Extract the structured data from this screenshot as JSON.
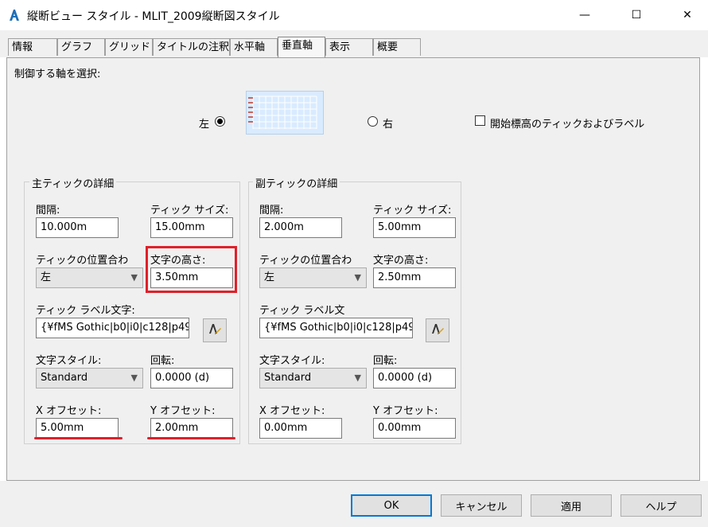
{
  "window": {
    "title": "縦断ビュー スタイル - MLIT_2009縦断図スタイル",
    "minimize": "—",
    "maximize": "☐",
    "close": "✕"
  },
  "tabs": [
    "情報",
    "グラフ",
    "グリッド",
    "タイトルの注釈",
    "水平軸",
    "垂直軸",
    "表示",
    "概要"
  ],
  "active_tab": "垂直軸",
  "axis_select": {
    "label": "制御する軸を選択:",
    "left_label": "左",
    "right_label": "右",
    "selected": "左",
    "checkbox_label": "開始標高のティックおよびラベル",
    "checkbox_checked": false
  },
  "major": {
    "title": "主ティックの詳細",
    "interval_label": "間隔:",
    "interval_value": "10.000m",
    "tick_size_label": "ティック サイズ:",
    "tick_size_value": "15.00mm",
    "tick_justify_label": "ティックの位置合わ",
    "tick_justify_value": "左",
    "text_height_label": "文字の高さ:",
    "text_height_value": "3.50mm",
    "label_text_label": "ティック ラベル文字:",
    "label_text_value": "{¥fMS Gothic|b0|i0|c128|p49",
    "text_style_label": "文字スタイル:",
    "text_style_value": "Standard",
    "rotation_label": "回転:",
    "rotation_value": "0.0000 (d)",
    "x_offset_label": "X オフセット:",
    "x_offset_value": "5.00mm",
    "y_offset_label": "Y オフセット:",
    "y_offset_value": "2.00mm"
  },
  "minor": {
    "title": "副ティックの詳細",
    "interval_label": "間隔:",
    "interval_value": "2.000m",
    "tick_size_label": "ティック サイズ:",
    "tick_size_value": "5.00mm",
    "tick_justify_label": "ティックの位置合わ",
    "tick_justify_value": "左",
    "text_height_label": "文字の高さ:",
    "text_height_value": "2.50mm",
    "label_text_label": "ティック ラベル文",
    "label_text_value": "{¥fMS Gothic|b0|i0|c128|p49",
    "text_style_label": "文字スタイル:",
    "text_style_value": "Standard",
    "rotation_label": "回転:",
    "rotation_value": "0.0000 (d)",
    "x_offset_label": "X オフセット:",
    "x_offset_value": "0.00mm",
    "y_offset_label": "Y オフセット:",
    "y_offset_value": "0.00mm"
  },
  "buttons": {
    "ok": "OK",
    "cancel": "キャンセル",
    "apply": "適用",
    "help": "ヘルプ"
  },
  "colors": {
    "highlight": "#e0202a",
    "preview_fill": "#d9ebff",
    "default_button_border": "#0078d7"
  }
}
